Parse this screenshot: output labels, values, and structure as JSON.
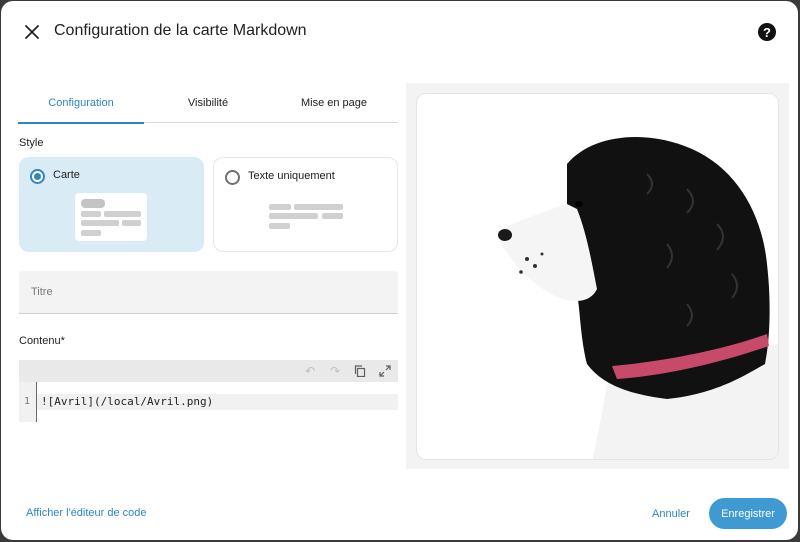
{
  "dialog": {
    "title": "Configuration de la carte Markdown",
    "help_glyph": "?"
  },
  "tabs": [
    {
      "label": "Configuration",
      "active": true
    },
    {
      "label": "Visibilité",
      "active": false
    },
    {
      "label": "Mise en page",
      "active": false
    }
  ],
  "style": {
    "label": "Style",
    "options": [
      {
        "label": "Carte",
        "selected": true
      },
      {
        "label": "Texte uniquement",
        "selected": false
      }
    ]
  },
  "title_field": {
    "placeholder": "Titre",
    "value": ""
  },
  "content": {
    "label": "Contenu*",
    "lines": [
      {
        "number": "1",
        "text": "![Avril](/local/Avril.png)"
      }
    ],
    "toolbar_icons": [
      "undo-icon",
      "redo-icon",
      "copy-icon",
      "fullscreen-icon"
    ]
  },
  "footer": {
    "code_editor_link": "Afficher l'éditeur de code",
    "cancel_label": "Annuler",
    "save_label": "Enregistrer"
  },
  "colors": {
    "accent": "#2d86c3",
    "primary_button": "#3f9ad3",
    "selected_option_bg": "#d9ebf4"
  },
  "preview": {
    "image_subject": "black-and-white spaniel dog in profile with red collar"
  }
}
